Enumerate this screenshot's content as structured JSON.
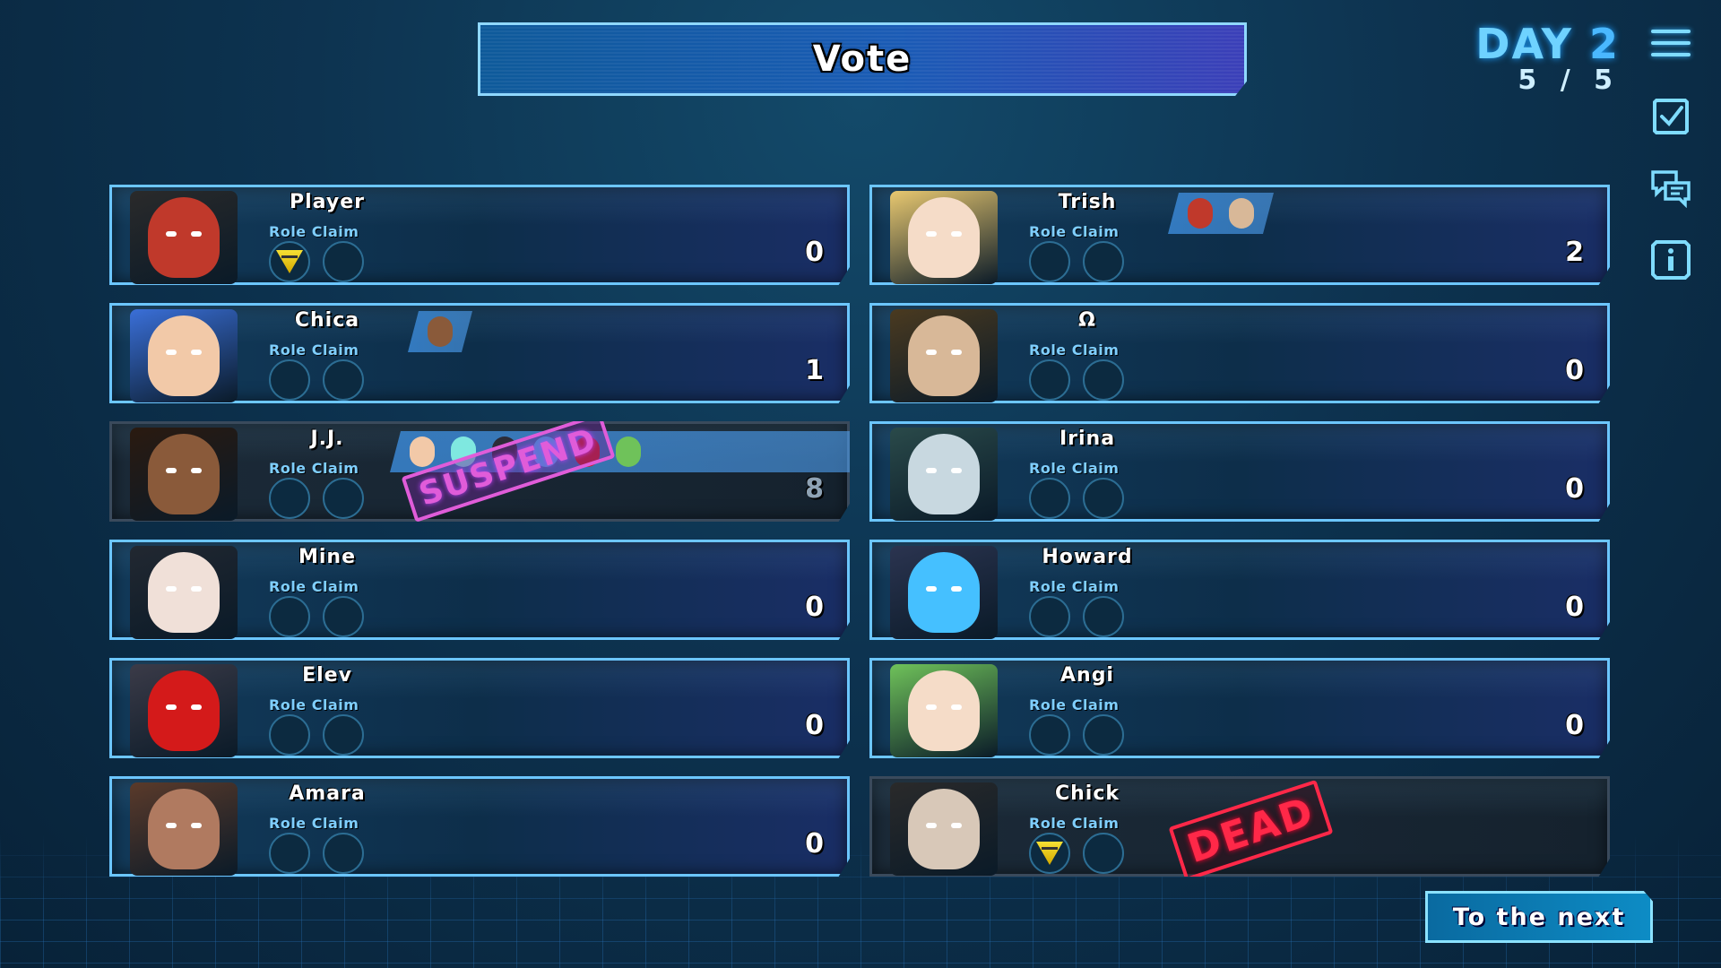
{
  "title": "Vote",
  "day": {
    "label": "DAY",
    "number": "2",
    "progress": "5 / 5"
  },
  "role_claim_label": "Role Claim",
  "next_button": "To the next",
  "stamps": {
    "suspend": "SUSPEND",
    "dead": "DEAD"
  },
  "colors": {
    "accent": "#6cc6ff",
    "title_gradient_end": "#3b3fb8",
    "suspend": "#e05cd9",
    "dead": "#ff2848",
    "claim_badge": "#f7e034"
  },
  "side_menu": [
    "menu-icon",
    "checklist-icon",
    "chat-icon",
    "info-icon"
  ],
  "players": [
    {
      "name": "Player",
      "votes": "0",
      "claims": [
        "badge",
        ""
      ],
      "voters": [],
      "status": "alive",
      "portrait": "rn-logo"
    },
    {
      "name": "Chica",
      "votes": "1",
      "claims": [
        "",
        ""
      ],
      "voters": [
        "J.J."
      ],
      "status": "alive",
      "portrait": "chica"
    },
    {
      "name": "J.J.",
      "votes": "8",
      "claims": [
        "",
        ""
      ],
      "voters": [
        "Chica",
        "Irina",
        "Mine",
        "Howard",
        "Elev",
        "Angi"
      ],
      "status": "suspended",
      "portrait": "jj"
    },
    {
      "name": "Mine",
      "votes": "0",
      "claims": [
        "",
        ""
      ],
      "voters": [],
      "status": "alive",
      "portrait": "mine"
    },
    {
      "name": "Elev",
      "votes": "0",
      "claims": [
        "",
        ""
      ],
      "voters": [],
      "status": "alive",
      "portrait": "elev"
    },
    {
      "name": "Amara",
      "votes": "0",
      "claims": [
        "",
        ""
      ],
      "voters": [],
      "status": "alive",
      "portrait": "amara"
    },
    {
      "name": "Trish",
      "votes": "2",
      "claims": [
        "",
        ""
      ],
      "voters": [
        "Player",
        "Ω"
      ],
      "status": "alive",
      "portrait": "trish"
    },
    {
      "name": "Ω",
      "votes": "0",
      "claims": [
        "",
        ""
      ],
      "voters": [],
      "status": "alive",
      "portrait": "omega"
    },
    {
      "name": "Irina",
      "votes": "0",
      "claims": [
        "",
        ""
      ],
      "voters": [],
      "status": "alive",
      "portrait": "irina"
    },
    {
      "name": "Howard",
      "votes": "0",
      "claims": [
        "",
        ""
      ],
      "voters": [],
      "status": "alive",
      "portrait": "howard"
    },
    {
      "name": "Angi",
      "votes": "0",
      "claims": [
        "",
        ""
      ],
      "voters": [],
      "status": "alive",
      "portrait": "angi"
    },
    {
      "name": "Chick",
      "votes": "",
      "claims": [
        "badge",
        ""
      ],
      "voters": [],
      "status": "dead",
      "portrait": "chick"
    }
  ]
}
